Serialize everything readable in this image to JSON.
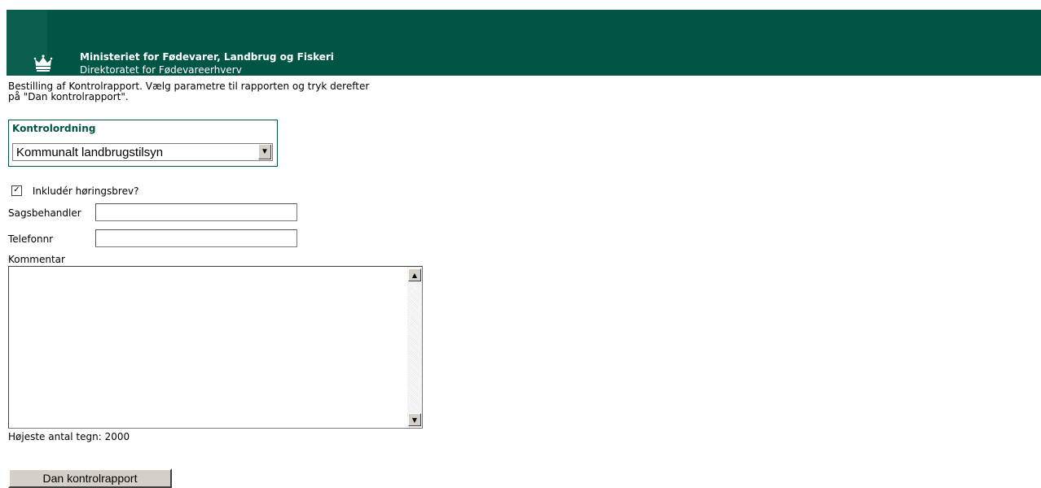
{
  "header": {
    "ministry": "Ministeriet for Fødevarer, Landbrug og Fiskeri",
    "directorate": "Direktoratet for Fødevareerhverv",
    "logo": "crown-icon",
    "background_color": "#005545"
  },
  "intro": {
    "line1": "Bestilling af Kontrolrapport. Vælg parametre til rapporten og tryk derefter",
    "line2": "på \"Dan kontrolrapport\"."
  },
  "kontrolordning": {
    "legend": "Kontrolordning",
    "selected": "Kommunalt landbrugstilsyn"
  },
  "form": {
    "include_hearing_letter": {
      "label": "Inkludér høringsbrev?",
      "checked": true
    },
    "caseworker": {
      "label": "Sagsbehandler",
      "value": ""
    },
    "phone": {
      "label": "Telefonnr",
      "value": ""
    },
    "comment": {
      "label": "Kommentar",
      "value": ""
    },
    "max_chars_text": "Højeste antal tegn: 2000"
  },
  "actions": {
    "submit_label": "Dan kontrolrapport"
  }
}
